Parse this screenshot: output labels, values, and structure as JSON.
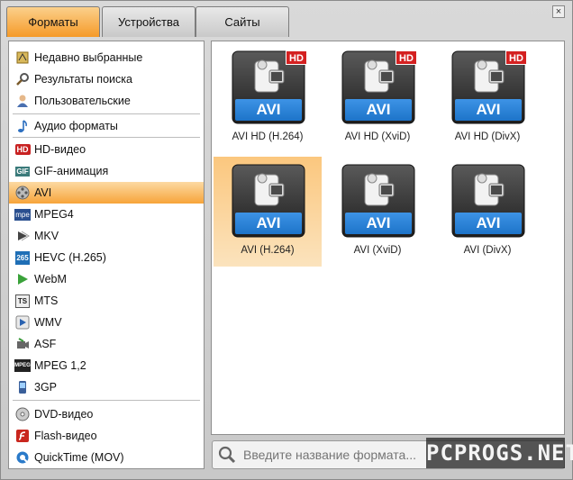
{
  "tabs": [
    {
      "label": "Форматы",
      "active": true
    },
    {
      "label": "Устройства",
      "active": false
    },
    {
      "label": "Сайты",
      "active": false
    }
  ],
  "close_label": "×",
  "sidebar": {
    "items": [
      {
        "label": "Недавно выбранные",
        "icon": "recent-icon"
      },
      {
        "label": "Результаты поиска",
        "icon": "search-results-icon"
      },
      {
        "label": "Пользовательские",
        "icon": "user-icon"
      },
      {
        "label": "Аудио форматы",
        "icon": "music-note-icon"
      },
      {
        "label": "HD-видео",
        "icon": "hd-icon"
      },
      {
        "label": "GIF-анимация",
        "icon": "gif-icon"
      },
      {
        "label": "AVI",
        "icon": "film-reel-icon",
        "selected": true
      },
      {
        "label": "MPEG4",
        "icon": "mpeg4-icon"
      },
      {
        "label": "MKV",
        "icon": "mkv-icon"
      },
      {
        "label": "HEVC (H.265)",
        "icon": "hevc-icon"
      },
      {
        "label": "WebM",
        "icon": "webm-play-icon"
      },
      {
        "label": "MTS",
        "icon": "mts-icon"
      },
      {
        "label": "WMV",
        "icon": "wmv-icon"
      },
      {
        "label": "ASF",
        "icon": "asf-icon"
      },
      {
        "label": "MPEG 1,2",
        "icon": "mpeg12-icon"
      },
      {
        "label": "3GP",
        "icon": "phone-icon"
      },
      {
        "label": "DVD-видео",
        "icon": "dvd-icon"
      },
      {
        "label": "Flash-видео",
        "icon": "flash-icon"
      },
      {
        "label": "QuickTime (MOV)",
        "icon": "quicktime-icon"
      }
    ],
    "badges": {
      "hd": "HD",
      "gif": "GIF",
      "mpeg4": "mpe",
      "hevc": "265",
      "mts": "TS",
      "mpeg12": "MPEG"
    }
  },
  "tiles": [
    {
      "caption": "AVI HD (H.264)",
      "label": "AVI",
      "hd": true,
      "hd_label": "HD"
    },
    {
      "caption": "AVI HD (XviD)",
      "label": "AVI",
      "hd": true,
      "hd_label": "HD"
    },
    {
      "caption": "AVI HD (DivX)",
      "label": "AVI",
      "hd": true,
      "hd_label": "HD"
    },
    {
      "caption": "AVI (H.264)",
      "label": "AVI",
      "hd": false,
      "selected": true
    },
    {
      "caption": "AVI (XviD)",
      "label": "AVI",
      "hd": false
    },
    {
      "caption": "AVI (DivX)",
      "label": "AVI",
      "hd": false
    }
  ],
  "search": {
    "placeholder": "Введите название формата..."
  },
  "watermark": "PCPROGS.NET",
  "colors": {
    "accent": "#f59a28",
    "tile_blue": "#1d74c9",
    "hd_red": "#d42020"
  }
}
